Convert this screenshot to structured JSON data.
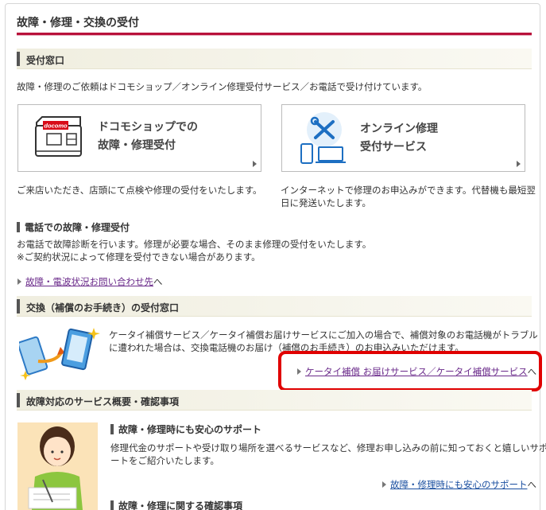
{
  "page": {
    "title": "故障・修理・交換の受付"
  },
  "reception": {
    "heading": "受付窓口",
    "intro": "故障・修理のご依頼はドコモショップ／オンライン修理受付サービス／お電話で受け付けています。",
    "shop_box": {
      "line1": "ドコモショップでの",
      "line2": "故障・修理受付",
      "logo_text": "docomo"
    },
    "shop_desc": "ご来店いただき、店頭にて点検や修理の受付をいたします。",
    "online_box": {
      "line1": "オンライン修理",
      "line2": "受付サービス"
    },
    "online_desc_line1": "インターネットで修理のお申込みができます。代替機も最短翌",
    "online_desc_line2": "日に発送いたします。",
    "phone_heading": "電話での故障・修理受付",
    "phone_desc_line1": "お電話で故障診断を行います。修理が必要な場合、そのまま修理の受付をいたします。",
    "phone_desc_line2": "※ご契約状況によって修理を受付できない場合があります。",
    "phone_link": "故障・電波状況お問い合わせ先",
    "phone_link_suffix": "へ"
  },
  "exchange": {
    "heading": "交換（補償のお手続き）の受付窓口",
    "desc_line1": "ケータイ補償サービス／ケータイ補償お届けサービスにご加入の場合で、補償対象のお電話機がトラブル",
    "desc_line2": "に遭われた場合は、交換電話機のお届け（補償のお手続き）のお申込みいただけます。",
    "link": "ケータイ補償 お届けサービス／ケータイ補償サービス",
    "link_suffix": "へ"
  },
  "service": {
    "heading": "故障対応のサービス概要・確認事項",
    "sub1_heading": "故障・修理時にも安心のサポート",
    "sub1_desc_line1": "修理代金のサポートや受け取り場所を選べるサービスなど、修理お申し込みの前に知っておくと嬉しいサポ",
    "sub1_desc_line2": "ートをご紹介いたします。",
    "sub1_link": "故障・修理時にも安心のサポート",
    "sub1_link_suffix": "へ",
    "sub2_heading": "故障・修理に関する確認事項"
  },
  "colors": {
    "accent": "#b8123b",
    "link": "#1a4fa0",
    "highlight": "#e00000"
  }
}
